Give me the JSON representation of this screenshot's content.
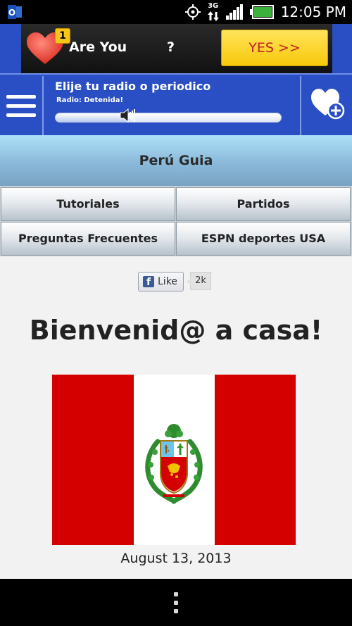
{
  "status_bar": {
    "network": "3G",
    "time": "12:05 PM",
    "icons": [
      "outlook-icon",
      "gps-icon",
      "data-arrows-icon",
      "signal-icon",
      "battery-icon"
    ]
  },
  "ad": {
    "badge": "1",
    "text": "Are You",
    "question": "?",
    "cta": "YES >>"
  },
  "app_bar": {
    "title": "Elije tu radio o periodico",
    "status": "Radio: Detenida!",
    "volume_fraction": 0.33,
    "colors": {
      "bar": "#2a4fc4"
    }
  },
  "page": {
    "site_title": "Perú Guia",
    "nav": [
      {
        "label": "Tutoriales"
      },
      {
        "label": "Partidos"
      },
      {
        "label": "Preguntas Frecuentes"
      },
      {
        "label": "ESPN deportes USA"
      }
    ],
    "like": {
      "icon_letter": "f",
      "label": "Like",
      "count": "2k"
    },
    "heading": "Bienvenid@ a casa!",
    "flag": {
      "colors": {
        "red": "#d40000",
        "white": "#ffffff"
      }
    },
    "date": "August 13, 2013"
  }
}
